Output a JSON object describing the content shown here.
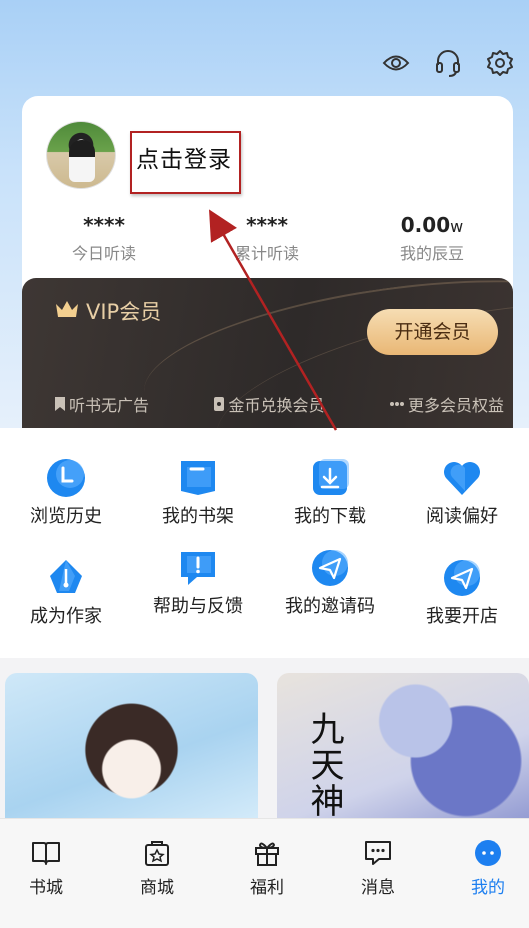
{
  "header": {
    "icons": [
      "eye-icon",
      "headset-icon",
      "gear-icon"
    ]
  },
  "profile": {
    "login_label": "点击登录",
    "stats": [
      {
        "value": "****",
        "unit": "",
        "label": "今日听读"
      },
      {
        "value": "****",
        "unit": "",
        "label": "累计听读"
      },
      {
        "value": "0.00",
        "unit": "w",
        "label": "我的辰豆"
      }
    ]
  },
  "vip": {
    "title": "VIP会员",
    "button": "开通会员",
    "benefits": [
      "听书无广告",
      "金币兑换会员",
      "更多会员权益"
    ]
  },
  "menu": {
    "items": [
      {
        "label": "浏览历史",
        "icon": "clock-icon"
      },
      {
        "label": "我的书架",
        "icon": "bookshelf-icon"
      },
      {
        "label": "我的下载",
        "icon": "download-icon"
      },
      {
        "label": "阅读偏好",
        "icon": "heart-icon"
      },
      {
        "label": "成为作家",
        "icon": "pen-icon"
      },
      {
        "label": "帮助与反馈",
        "icon": "feedback-icon"
      },
      {
        "label": "我的邀请码",
        "icon": "send-icon"
      },
      {
        "label": "我要开店",
        "icon": "send-icon"
      }
    ]
  },
  "banners": {
    "right_title": "九天神"
  },
  "tabbar": {
    "items": [
      {
        "label": "书城",
        "icon": "book-icon"
      },
      {
        "label": "商城",
        "icon": "shop-icon"
      },
      {
        "label": "福利",
        "icon": "gift-icon"
      },
      {
        "label": "消息",
        "icon": "message-icon"
      },
      {
        "label": "我的",
        "icon": "profile-icon"
      }
    ],
    "active": "我的"
  },
  "colors": {
    "accent": "#1d7ff0",
    "annotation": "#b22222",
    "vip_gold": "#e8cfa6"
  }
}
